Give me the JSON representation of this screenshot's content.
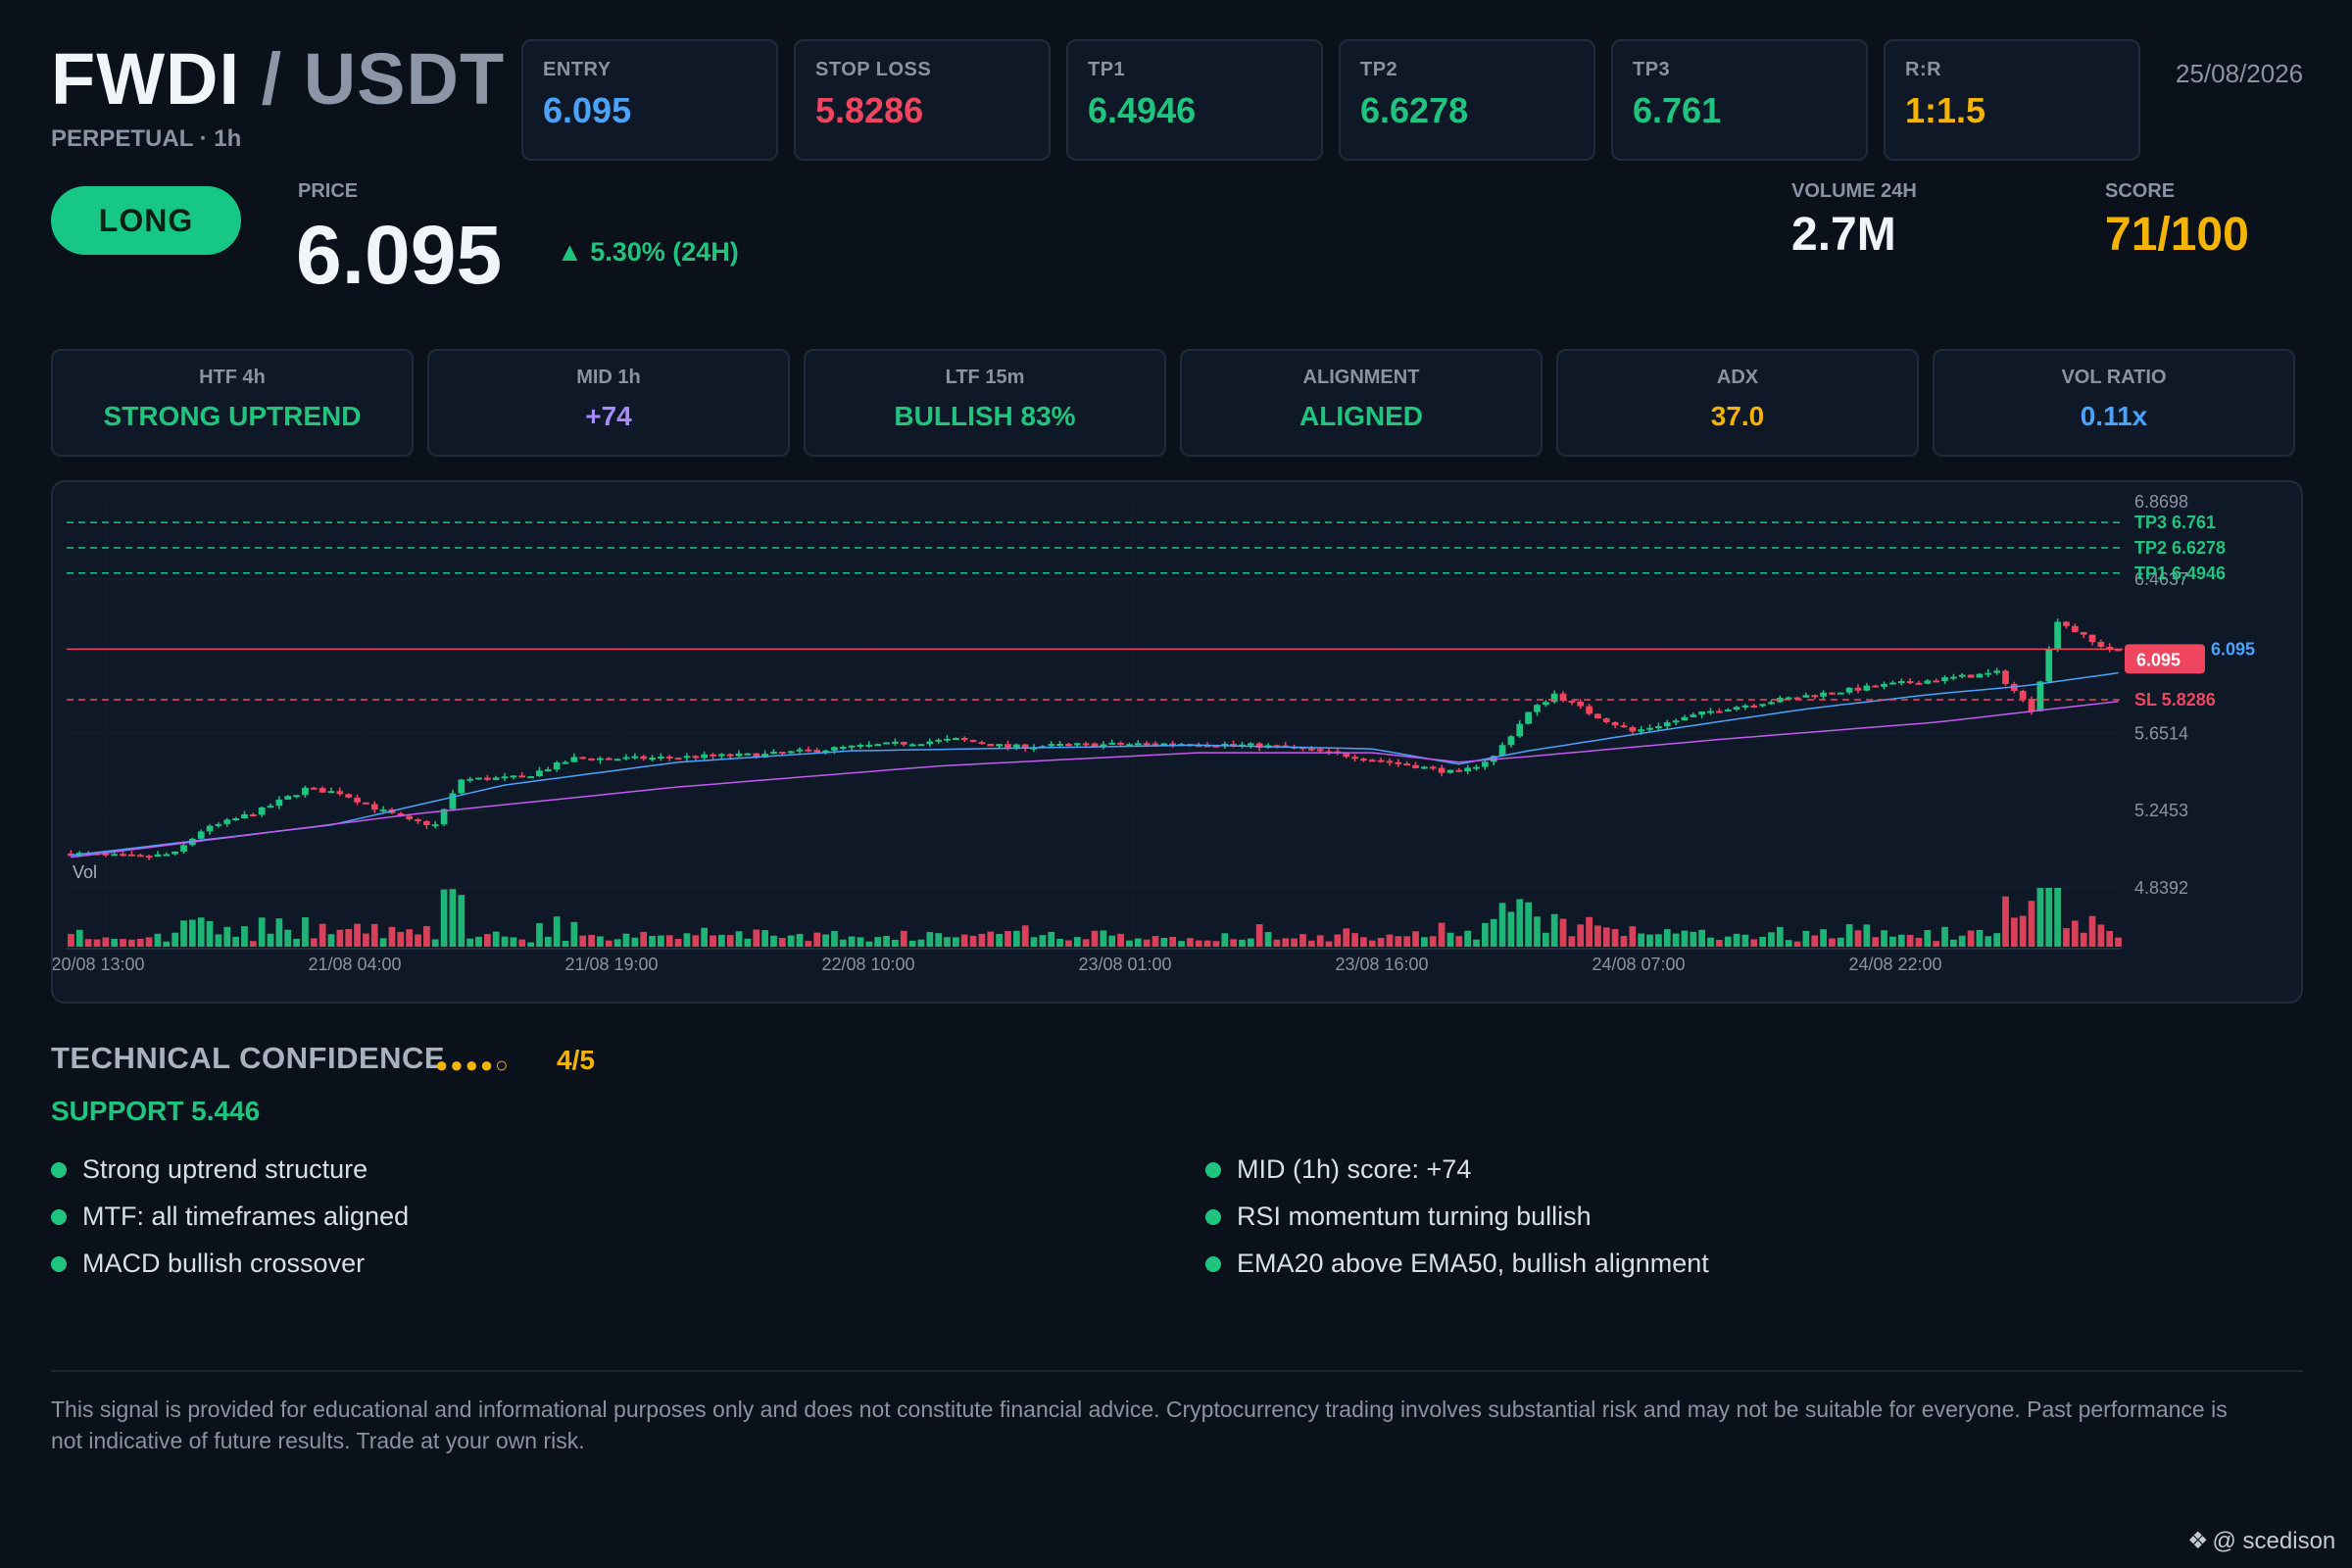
{
  "header": {
    "base": "FWDI",
    "sep": " / ",
    "quote": "USDT",
    "subtitle": "PERPETUAL · 1h",
    "date": "25/08/2026"
  },
  "levels": [
    {
      "label": "ENTRY",
      "value": "6.095",
      "color": "#4aa3ff"
    },
    {
      "label": "STOP LOSS",
      "value": "5.8286",
      "color": "#f0455f"
    },
    {
      "label": "TP1",
      "value": "6.4946",
      "color": "#1fc57f"
    },
    {
      "label": "TP2",
      "value": "6.6278",
      "color": "#1fc57f"
    },
    {
      "label": "TP3",
      "value": "6.761",
      "color": "#1fc57f"
    },
    {
      "label": "R:R",
      "value": "1:1.5",
      "color": "#f4b400"
    }
  ],
  "signal": {
    "direction": "LONG"
  },
  "price": {
    "label": "PRICE",
    "value": "6.095",
    "change": "▲ 5.30% (24H)"
  },
  "volume": {
    "label": "VOLUME 24H",
    "value": "2.7M"
  },
  "score": {
    "label": "SCORE",
    "value": "71/100"
  },
  "metrics": [
    {
      "label": "HTF 4h",
      "value": "STRONG UPTREND",
      "color": "#1fc57f"
    },
    {
      "label": "MID 1h",
      "value": "+74",
      "color": "#a78bfa"
    },
    {
      "label": "LTF 15m",
      "value": "BULLISH 83%",
      "color": "#1fc57f"
    },
    {
      "label": "ALIGNMENT",
      "value": "ALIGNED",
      "color": "#1fc57f"
    },
    {
      "label": "ADX",
      "value": "37.0",
      "color": "#f4b400"
    },
    {
      "label": "VOL RATIO",
      "value": "0.11x",
      "color": "#4aa3ff"
    }
  ],
  "confidence": {
    "title": "TECHNICAL CONFIDENCE",
    "dots": "●●●●○",
    "score": "4/5",
    "support": "SUPPORT 5.446"
  },
  "reasons_left": [
    "Strong uptrend structure",
    "MTF: all timeframes aligned",
    "MACD bullish crossover"
  ],
  "reasons_right": [
    "MID (1h) score: +74",
    "RSI momentum turning bullish",
    "EMA20 above EMA50, bullish alignment"
  ],
  "disclaimer": "This signal is provided for educational and informational purposes only and does not constitute financial advice. Cryptocurrency trading involves substantial risk and may not be suitable for everyone. Past performance is not indicative of future results. Trade at your own risk.",
  "watermark": {
    "text": "@ scedison",
    "logo_icon": "binance-diamond-icon"
  },
  "colors": {
    "bull": "#1fc57f",
    "bear": "#f0455f",
    "ema20": "#4aa3ff",
    "ema50": "#c45bf0",
    "tp": "#1fc57f",
    "sl": "#f0455f",
    "entry": "#f0455f"
  },
  "chart_data": {
    "type": "candlestick",
    "y_ticks": [
      "6.8698",
      "6.4637",
      "5.6514",
      "5.2453",
      "4.8392"
    ],
    "ylim": [
      4.8392,
      6.8698
    ],
    "x_tick_labels": [
      "20/08 13:00",
      "21/08 04:00",
      "21/08 19:00",
      "22/08 10:00",
      "23/08 01:00",
      "23/08 16:00",
      "24/08 07:00",
      "24/08 22:00"
    ],
    "volume_label": "Vol",
    "lines": [
      {
        "name": "TP3",
        "label": "TP3 6.761",
        "value": 6.761,
        "style": "dashed",
        "color": "#1fc57f"
      },
      {
        "name": "TP2",
        "label": "TP2 6.6278",
        "value": 6.6278,
        "style": "dashed",
        "color": "#1fc57f"
      },
      {
        "name": "TP1",
        "label": "TP1 6.4946",
        "value": 6.4946,
        "style": "dashed",
        "color": "#1fc57f"
      },
      {
        "name": "ENTRY",
        "label": "6.095",
        "value": 6.095,
        "style": "solid",
        "color": "#f0455f"
      },
      {
        "name": "SL",
        "label": "SL 5.8286",
        "value": 5.8286,
        "style": "dashed",
        "color": "#f0455f"
      }
    ],
    "last_price": "6.095",
    "ema20_last": "6.095",
    "close_anchors": [
      [
        0,
        5.02
      ],
      [
        8,
        5.0
      ],
      [
        12,
        5.02
      ],
      [
        15,
        5.14
      ],
      [
        22,
        5.25
      ],
      [
        27,
        5.36
      ],
      [
        31,
        5.34
      ],
      [
        35,
        5.26
      ],
      [
        39,
        5.19
      ],
      [
        42,
        5.17
      ],
      [
        45,
        5.41
      ],
      [
        52,
        5.42
      ],
      [
        58,
        5.52
      ],
      [
        65,
        5.52
      ],
      [
        80,
        5.54
      ],
      [
        90,
        5.58
      ],
      [
        102,
        5.62
      ],
      [
        108,
        5.58
      ],
      [
        115,
        5.59
      ],
      [
        130,
        5.6
      ],
      [
        140,
        5.58
      ],
      [
        148,
        5.53
      ],
      [
        155,
        5.48
      ],
      [
        160,
        5.44
      ],
      [
        164,
        5.53
      ],
      [
        168,
        5.76
      ],
      [
        171,
        5.86
      ],
      [
        175,
        5.76
      ],
      [
        180,
        5.66
      ],
      [
        190,
        5.78
      ],
      [
        200,
        5.85
      ],
      [
        210,
        5.91
      ],
      [
        218,
        5.95
      ],
      [
        222,
        5.97
      ],
      [
        226,
        5.78
      ],
      [
        229,
        6.25
      ],
      [
        233,
        6.13
      ],
      [
        236,
        6.08
      ]
    ],
    "ema20_anchors": [
      [
        0,
        5.01
      ],
      [
        30,
        5.17
      ],
      [
        50,
        5.38
      ],
      [
        70,
        5.5
      ],
      [
        90,
        5.56
      ],
      [
        130,
        5.59
      ],
      [
        150,
        5.57
      ],
      [
        160,
        5.49
      ],
      [
        168,
        5.56
      ],
      [
        185,
        5.68
      ],
      [
        200,
        5.78
      ],
      [
        215,
        5.86
      ],
      [
        225,
        5.9
      ],
      [
        236,
        5.97
      ]
    ],
    "ema50_anchors": [
      [
        0,
        5.0
      ],
      [
        40,
        5.23
      ],
      [
        70,
        5.37
      ],
      [
        100,
        5.48
      ],
      [
        130,
        5.55
      ],
      [
        150,
        5.55
      ],
      [
        160,
        5.5
      ],
      [
        168,
        5.53
      ],
      [
        190,
        5.62
      ],
      [
        215,
        5.71
      ],
      [
        236,
        5.82
      ]
    ],
    "candle_count": 237
  }
}
